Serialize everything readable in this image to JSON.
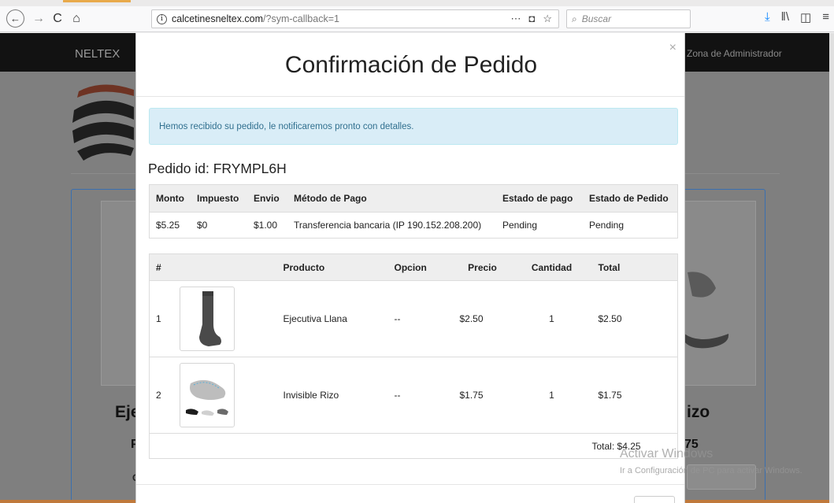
{
  "browser": {
    "url_host": "calcetinesneltex.com",
    "url_path": "/?sym-callback=1",
    "search_placeholder": "Buscar",
    "icons": [
      "back-icon",
      "forward-icon",
      "reload-icon",
      "home-icon",
      "info-icon",
      "more-icon",
      "pocket-icon",
      "bookmark-star-icon",
      "search-icon",
      "download-icon",
      "library-icon",
      "sidebar-icon",
      "menu-icon"
    ],
    "url_more": "⋯",
    "url_pocket": "◘",
    "url_star": "☆",
    "glyph_back": "←",
    "glyph_forward": "→",
    "glyph_reload": "C",
    "glyph_home": "⌂",
    "glyph_search": "⌕",
    "glyph_download": "⤓",
    "glyph_library": "‖\\",
    "glyph_sidebar": "◫",
    "glyph_menu": "≡"
  },
  "background_page": {
    "brand": "NELTEX",
    "admin_link": "Zona de Administrador",
    "heading_left": "Eje",
    "heading_right": "izo",
    "price_left": "P",
    "price_right": "75",
    "small_left": "C"
  },
  "modal": {
    "title": "Confirmación de Pedido",
    "close": "×",
    "alert": "Hemos recibido su pedido, le notificaremos pronto con detalles.",
    "order_id": "Pedido id: FRYMPL6H",
    "summary": {
      "headers": [
        "Monto",
        "Impuesto",
        "Envio",
        "Método de Pago",
        "Estado de pago",
        "Estado de Pedido"
      ],
      "row": [
        "$5.25",
        "$0",
        "$1.00",
        "Transferencia bancaria (IP 190.152.208.200)",
        "Pending",
        "Pending"
      ]
    },
    "items": {
      "headers": [
        "#",
        "",
        "Producto",
        "Opcion",
        "Precio",
        "Cantidad",
        "Total"
      ],
      "rows": [
        {
          "num": "1",
          "product": "Ejecutiva Llana",
          "option": "--",
          "price": "$2.50",
          "qty": "1",
          "total": "$2.50"
        },
        {
          "num": "2",
          "product": "Invisible Rizo",
          "option": "--",
          "price": "$1.75",
          "qty": "1",
          "total": "$1.75"
        }
      ],
      "grand_total": "Total: $4.25"
    }
  },
  "watermark": {
    "line1": "Activar Windows",
    "line2": "Ir a Configuración de PC para activar Windows."
  }
}
